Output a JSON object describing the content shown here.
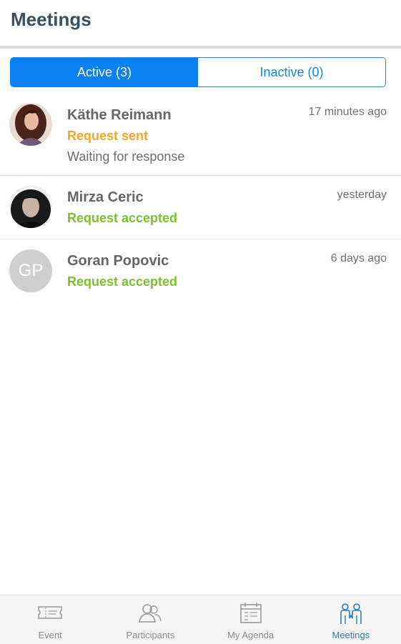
{
  "header": {
    "title": "Meetings"
  },
  "segments": {
    "active_label": "Active (3)",
    "inactive_label": "Inactive (0)"
  },
  "meetings": [
    {
      "name": "Käthe Reimann",
      "status": "Request sent",
      "status_color": "#f5a623",
      "subtext": "Waiting for response",
      "time": "17 minutes ago"
    },
    {
      "name": "Mirza Ceric",
      "status": "Request accepted",
      "status_color": "#7cc12c",
      "subtext": "",
      "time": "yesterday"
    },
    {
      "name": "Goran Popovic",
      "status": "Request accepted",
      "status_color": "#7cc12c",
      "subtext": "",
      "time": "6 days ago",
      "initials": "GP"
    }
  ],
  "tabbar": {
    "items": [
      {
        "label": "Event",
        "icon": "ticket-icon"
      },
      {
        "label": "Participants",
        "icon": "people-icon"
      },
      {
        "label": "My Agenda",
        "icon": "calendar-icon"
      },
      {
        "label": "Meetings",
        "icon": "meeting-icon",
        "selected": true
      }
    ]
  },
  "colors": {
    "accent": "#0b80f3",
    "selected_tab": "#2a7fb0"
  }
}
